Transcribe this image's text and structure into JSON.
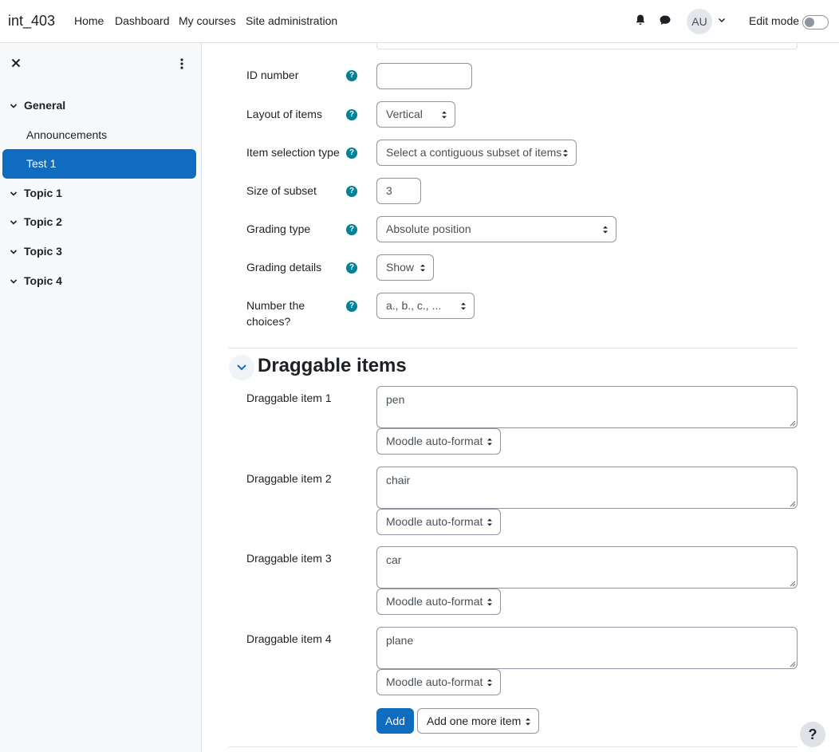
{
  "navbar": {
    "brand": "int_403",
    "links": [
      "Home",
      "Dashboard",
      "My courses",
      "Site administration"
    ],
    "avatar": "AU",
    "edit_mode": "Edit mode"
  },
  "drawer": {
    "sections": [
      "General",
      "Topic 1",
      "Topic 2",
      "Topic 3",
      "Topic 4"
    ],
    "items": [
      "Announcements",
      "Test 1"
    ]
  },
  "form": {
    "id_number": {
      "label": "ID number",
      "value": ""
    },
    "layout": {
      "label": "Layout of items",
      "value": "Vertical"
    },
    "selection_type": {
      "label": "Item selection type",
      "value": "Select a contiguous subset of items"
    },
    "subset_size": {
      "label": "Size of subset",
      "value": "3"
    },
    "grading_type": {
      "label": "Grading type",
      "value": "Absolute position"
    },
    "grading_details": {
      "label": "Grading details",
      "value": "Show"
    },
    "numbering": {
      "label_line1": "Number the",
      "label_line2": "choices?",
      "value": "a., b., c., ..."
    }
  },
  "draggable": {
    "title": "Draggable items",
    "items": [
      {
        "label": "Draggable item 1",
        "text": "pen",
        "format": "Moodle auto-format"
      },
      {
        "label": "Draggable item 2",
        "text": "chair",
        "format": "Moodle auto-format"
      },
      {
        "label": "Draggable item 3",
        "text": "car",
        "format": "Moodle auto-format"
      },
      {
        "label": "Draggable item 4",
        "text": "plane",
        "format": "Moodle auto-format"
      }
    ],
    "add_button": "Add",
    "add_more": "Add one more item"
  },
  "help_button": "?"
}
